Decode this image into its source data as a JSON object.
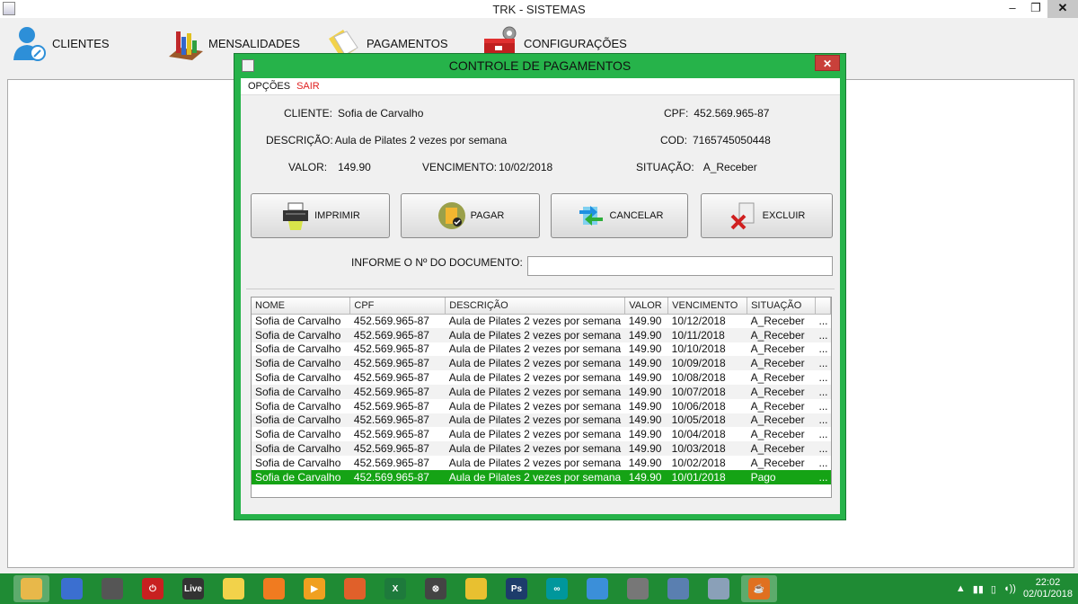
{
  "window": {
    "title": "TRK - SISTEMAS",
    "controls": {
      "minimize": "–",
      "maximize": "❐",
      "close": "✕"
    }
  },
  "main_menu": [
    {
      "label": "CLIENTES",
      "icon": "user-icon"
    },
    {
      "label": "MENSALIDADES",
      "icon": "bar-chart-icon"
    },
    {
      "label": "PAGAMENTOS",
      "icon": "documents-icon"
    },
    {
      "label": "CONFIGURAÇÕES",
      "icon": "toolbox-gear-icon"
    }
  ],
  "dialog": {
    "title": "CONTROLE DE PAGAMENTOS",
    "close": "✕",
    "menu": {
      "opcoes": "OPÇÕES",
      "sair": "SAIR"
    },
    "cliente_label": "CLIENTE:",
    "cliente_value": "Sofia de Carvalho",
    "cpf_label": "CPF:",
    "cpf_value": "452.569.965-87",
    "descricao_label": "DESCRIÇÃO:",
    "descricao_value": "Aula de Pilates 2 vezes por semana",
    "cod_label": "COD:",
    "cod_value": "7165745050448",
    "valor_label": "VALOR:",
    "valor_value": "149.90",
    "vencimento_label": "VENCIMENTO:",
    "vencimento_value": "10/02/2018",
    "situacao_label": "SITUAÇÃO:",
    "situacao_value": "A_Receber",
    "buttons": {
      "imprimir": "IMPRIMIR",
      "pagar": "PAGAR",
      "cancelar": "CANCELAR",
      "excluir": "EXCLUIR"
    },
    "doc_label": "INFORME O Nº DO DOCUMENTO:",
    "doc_value": "",
    "table": {
      "headers": [
        "NOME",
        "CPF",
        "DESCRIÇÃO",
        "VALOR",
        "VENCIMENTO",
        "SITUAÇÃO",
        ""
      ],
      "rows": [
        [
          "Sofia de Carvalho",
          "452.569.965-87",
          "Aula de Pilates 2 vezes por semana",
          "149.90",
          "10/12/2018",
          "A_Receber",
          "..."
        ],
        [
          "Sofia de Carvalho",
          "452.569.965-87",
          "Aula de Pilates 2 vezes por semana",
          "149.90",
          "10/11/2018",
          "A_Receber",
          "..."
        ],
        [
          "Sofia de Carvalho",
          "452.569.965-87",
          "Aula de Pilates 2 vezes por semana",
          "149.90",
          "10/10/2018",
          "A_Receber",
          "..."
        ],
        [
          "Sofia de Carvalho",
          "452.569.965-87",
          "Aula de Pilates 2 vezes por semana",
          "149.90",
          "10/09/2018",
          "A_Receber",
          "..."
        ],
        [
          "Sofia de Carvalho",
          "452.569.965-87",
          "Aula de Pilates 2 vezes por semana",
          "149.90",
          "10/08/2018",
          "A_Receber",
          "..."
        ],
        [
          "Sofia de Carvalho",
          "452.569.965-87",
          "Aula de Pilates 2 vezes por semana",
          "149.90",
          "10/07/2018",
          "A_Receber",
          "..."
        ],
        [
          "Sofia de Carvalho",
          "452.569.965-87",
          "Aula de Pilates 2 vezes por semana",
          "149.90",
          "10/06/2018",
          "A_Receber",
          "..."
        ],
        [
          "Sofia de Carvalho",
          "452.569.965-87",
          "Aula de Pilates 2 vezes por semana",
          "149.90",
          "10/05/2018",
          "A_Receber",
          "..."
        ],
        [
          "Sofia de Carvalho",
          "452.569.965-87",
          "Aula de Pilates 2 vezes por semana",
          "149.90",
          "10/04/2018",
          "A_Receber",
          "..."
        ],
        [
          "Sofia de Carvalho",
          "452.569.965-87",
          "Aula de Pilates 2 vezes por semana",
          "149.90",
          "10/03/2018",
          "A_Receber",
          "..."
        ],
        [
          "Sofia de Carvalho",
          "452.569.965-87",
          "Aula de Pilates 2 vezes por semana",
          "149.90",
          "10/02/2018",
          "A_Receber",
          "..."
        ],
        [
          "Sofia de Carvalho",
          "452.569.965-87",
          "Aula de Pilates 2 vezes por semana",
          "149.90",
          "10/01/2018",
          "Pago",
          "..."
        ]
      ],
      "selected_row": 11
    }
  },
  "taskbar": {
    "apps": [
      {
        "icon": "file-explorer-icon",
        "color": "#e8b84a",
        "glyph": "",
        "active": true
      },
      {
        "icon": "control-panel-icon",
        "color": "#3b6fd0",
        "glyph": ""
      },
      {
        "icon": "camera-app-icon",
        "color": "#555555",
        "glyph": ""
      },
      {
        "icon": "power-icon",
        "color": "#c82020",
        "glyph": "⏻"
      },
      {
        "icon": "live-icon",
        "color": "#333333",
        "glyph": "Live"
      },
      {
        "icon": "mountain-app-icon",
        "color": "#f2d24a",
        "glyph": ""
      },
      {
        "icon": "photo-app-icon",
        "color": "#f07b20",
        "glyph": ""
      },
      {
        "icon": "media-player-icon",
        "color": "#f0a020",
        "glyph": "▶"
      },
      {
        "icon": "firefox-icon",
        "color": "#e0602a",
        "glyph": ""
      },
      {
        "icon": "excel-icon",
        "color": "#1e7a3c",
        "glyph": "X"
      },
      {
        "icon": "connectivity-icon",
        "color": "#444444",
        "glyph": "⊗"
      },
      {
        "icon": "tool-app-icon",
        "color": "#e8c030",
        "glyph": ""
      },
      {
        "icon": "photoshop-icon",
        "color": "#1d3c6b",
        "glyph": "Ps"
      },
      {
        "icon": "arduino-icon",
        "color": "#00979c",
        "glyph": "∞"
      },
      {
        "icon": "cube-app-icon",
        "color": "#3b8fd9",
        "glyph": ""
      },
      {
        "icon": "monitor-app-icon",
        "color": "#777777",
        "glyph": ""
      },
      {
        "icon": "network-app-icon",
        "color": "#5a7fb0",
        "glyph": ""
      },
      {
        "icon": "paint-icon",
        "color": "#8aa0b8",
        "glyph": ""
      },
      {
        "icon": "java-icon",
        "color": "#e07020",
        "glyph": "☕",
        "active": true
      }
    ],
    "time": "22:02",
    "date": "02/01/2018"
  }
}
